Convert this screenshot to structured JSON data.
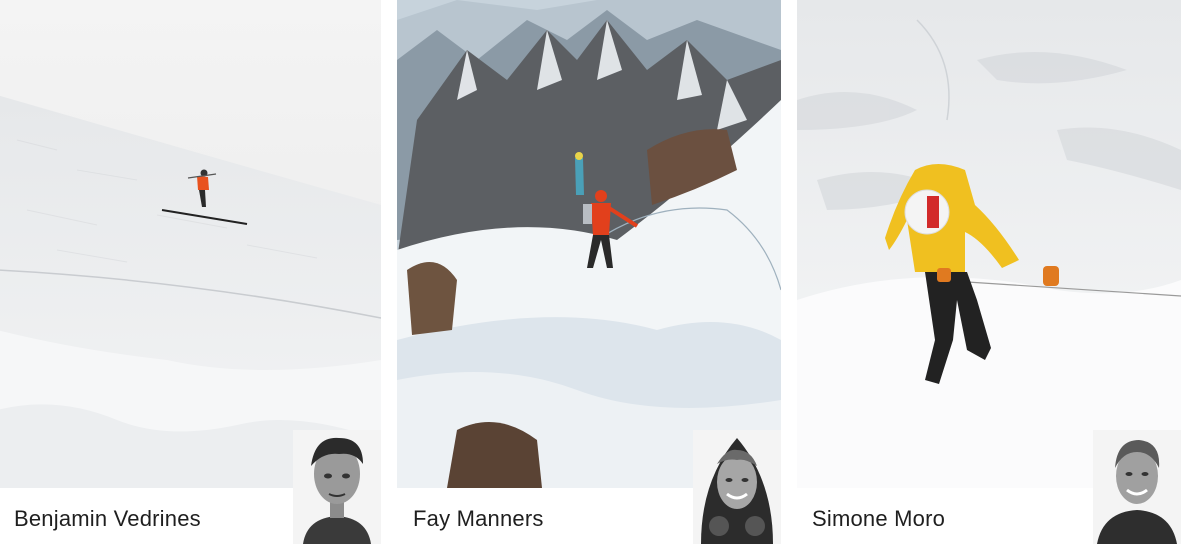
{
  "athletes": [
    {
      "name": "Benjamin Vedrines",
      "photo_icon": "skier-on-snow-slope-photo",
      "portrait_icon": "benjamin-vedrines-portrait"
    },
    {
      "name": "Fay Manners",
      "photo_icon": "climber-on-snowy-ridge-photo",
      "portrait_icon": "fay-manners-portrait"
    },
    {
      "name": "Simone Moro",
      "photo_icon": "mountaineer-in-yellow-jacket-photo",
      "portrait_icon": "simone-moro-portrait"
    }
  ]
}
